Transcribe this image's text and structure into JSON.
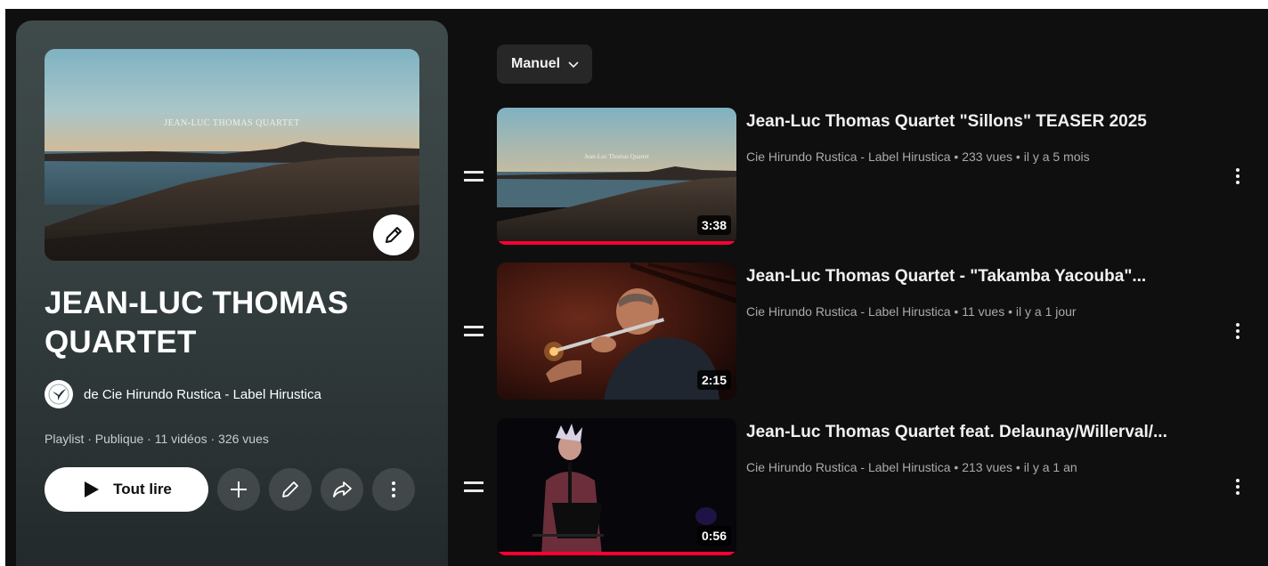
{
  "playlist": {
    "hero_overlay_text": "JEAN-LUC THOMAS QUARTET",
    "title": "JEAN-LUC THOMAS QUARTET",
    "owner": "de Cie Hirundo Rustica - Label Hirustica",
    "meta": "Playlist · Publique · 11 vidéos · 326 vues",
    "play_all_label": "Tout lire",
    "icons": {
      "edit_thumbnail": "pencil-icon",
      "add": "plus-icon",
      "edit": "pencil-icon",
      "share": "share-icon",
      "more": "more-vertical-icon",
      "avatar": "swallow-logo-icon"
    }
  },
  "sort": {
    "label": "Manuel",
    "icon": "chevron-down-icon"
  },
  "videos": [
    {
      "title": "Jean-Luc Thomas Quartet \"Sillons\" TEASER 2025",
      "meta": "Cie Hirundo Rustica - Label Hirustica • 233 vues • il y a 5 mois",
      "duration": "3:38",
      "thumb_overlay_text": "Jean-Luc Thomas Quartet",
      "watched_fraction": 1.0
    },
    {
      "title": "Jean-Luc Thomas Quartet - \"Takamba Yacouba\"...",
      "meta": "Cie Hirundo Rustica - Label Hirustica • 11 vues • il y a 1 jour",
      "duration": "2:15",
      "watched_fraction": 0.0
    },
    {
      "title": "Jean-Luc Thomas Quartet feat. Delaunay/Willerval/...",
      "meta": "Cie Hirundo Rustica - Label Hirustica • 213 vues • il y a 1 an",
      "duration": "0:56",
      "watched_fraction": 1.0
    }
  ],
  "colors": {
    "background": "#0f0f0f",
    "progress_red": "#ff0033",
    "panel_top": "#3f4a4b"
  }
}
